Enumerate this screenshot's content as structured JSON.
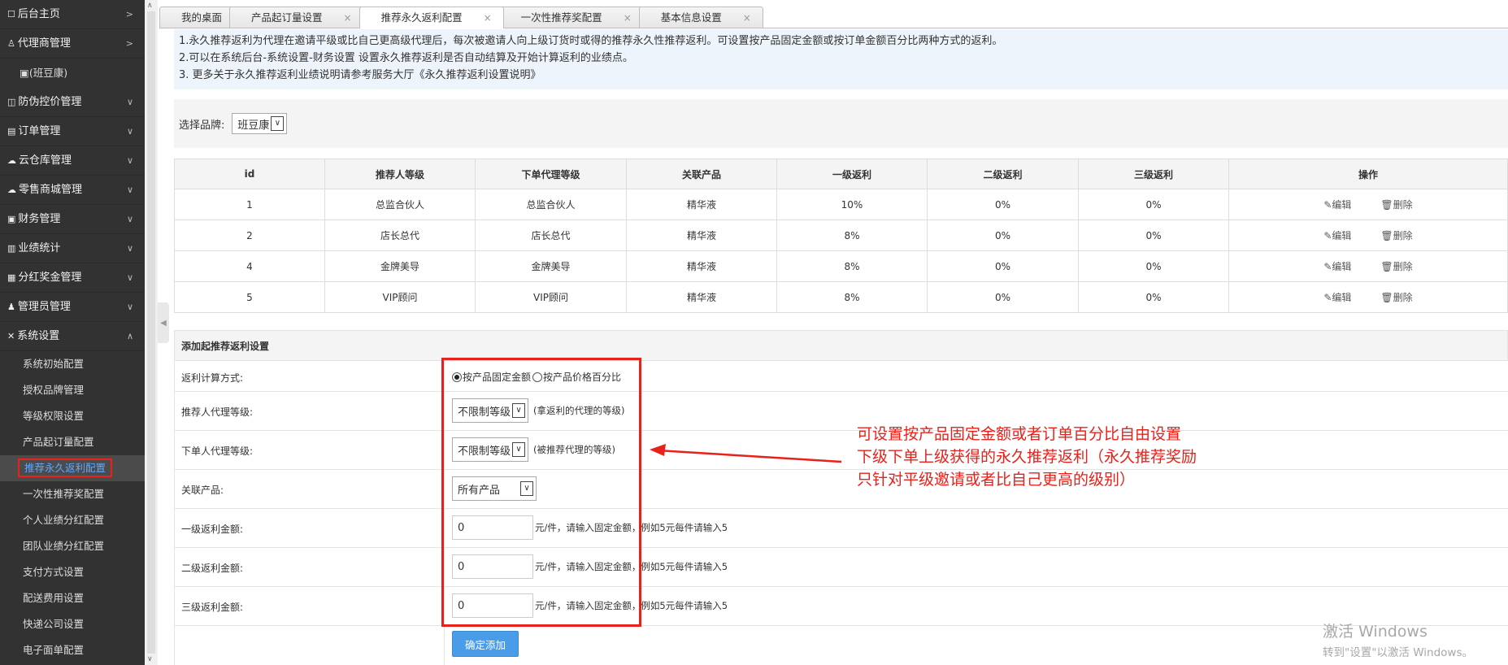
{
  "sidebar": {
    "home": "后台主页",
    "agent_mgmt": "代理商管理",
    "agent_user": "(班豆康)",
    "anti_fake": "防伪控价管理",
    "orders": "订单管理",
    "warehouse": "云仓库管理",
    "retail": "零售商城管理",
    "finance": "财务管理",
    "performance": "业绩统计",
    "bonus": "分红奖金管理",
    "admin": "管理员管理",
    "system": "系统设置",
    "sub_items": [
      "系统初始配置",
      "授权品牌管理",
      "等级权限设置",
      "产品起订量配置",
      "推荐永久返利配置",
      "一次性推荐奖配置",
      "个人业绩分红配置",
      "团队业绩分红配置",
      "支付方式设置",
      "配送费用设置",
      "快递公司设置",
      "电子面单配置"
    ]
  },
  "tabs": [
    {
      "label": "我的桌面",
      "closable": false
    },
    {
      "label": "产品起订量设置",
      "closable": true
    },
    {
      "label": "推荐永久返利配置",
      "closable": true
    },
    {
      "label": "一次性推荐奖配置",
      "closable": true
    },
    {
      "label": "基本信息设置",
      "closable": true
    }
  ],
  "notice": {
    "line1": "1.永久推荐返利为代理在邀请平级或比自己更高级代理后，每次被邀请人向上级订货时或得的推荐永久性推荐返利。可设置按产品固定金额或按订单金额百分比两种方式的返利。",
    "line2": "2.可以在系统后台-系统设置-财务设置 设置永久推荐返利是否自动结算及开始计算返利的业绩点。",
    "line3": "3. 更多关于永久推荐返利业绩说明请参考服务大厅《永久推荐返利设置说明》"
  },
  "brand": {
    "label": "选择品牌:",
    "value": "班豆康"
  },
  "table": {
    "headers": [
      "id",
      "推荐人等级",
      "下单代理等级",
      "关联产品",
      "一级返利",
      "二级返利",
      "三级返利",
      "操作"
    ],
    "edit_label": "编辑",
    "delete_label": "删除",
    "rows": [
      [
        "1",
        "总监合伙人",
        "总监合伙人",
        "精华液",
        "10%",
        "0%",
        "0%"
      ],
      [
        "2",
        "店长总代",
        "店长总代",
        "精华液",
        "8%",
        "0%",
        "0%"
      ],
      [
        "4",
        "金牌美导",
        "金牌美导",
        "精华液",
        "8%",
        "0%",
        "0%"
      ],
      [
        "5",
        "VIP顾问",
        "VIP顾问",
        "精华液",
        "8%",
        "0%",
        "0%"
      ]
    ]
  },
  "form": {
    "title": "添加起推荐返利设置",
    "calc_label": "返利计算方式:",
    "radio_fixed": "按产品固定金额",
    "radio_percent": "按产品价格百分比",
    "referrer_label": "推荐人代理等级:",
    "referrer_value": "不限制等级",
    "referrer_hint": "(拿返利的代理的等级)",
    "buyer_label": "下单人代理等级:",
    "buyer_value": "不限制等级",
    "buyer_hint": "(被推荐代理的等级)",
    "product_label": "关联产品:",
    "product_value": "所有产品",
    "level1_label": "一级返利金额:",
    "level2_label": "二级返利金额:",
    "level3_label": "三级返利金额:",
    "amount_value": "0",
    "amount_hint": "元/件，请输入固定金额，例如5元每件请输入5",
    "submit": "确定添加"
  },
  "annotation": {
    "line1": "可设置按产品固定金额或者订单百分比自由设置",
    "line2": "下级下单上级获得的永久推荐返利（永久推荐奖励",
    "line3": "只针对平级邀请或者比自己更高的级别）"
  },
  "watermark": {
    "line1": "激活 Windows",
    "line2": "转到\"设置\"以激活 Windows。"
  },
  "colors": {
    "sidebar_bg": "#323232",
    "accent": "#4a9be8",
    "annotation_red": "#e8211b",
    "active_link": "#5fa7ff"
  }
}
